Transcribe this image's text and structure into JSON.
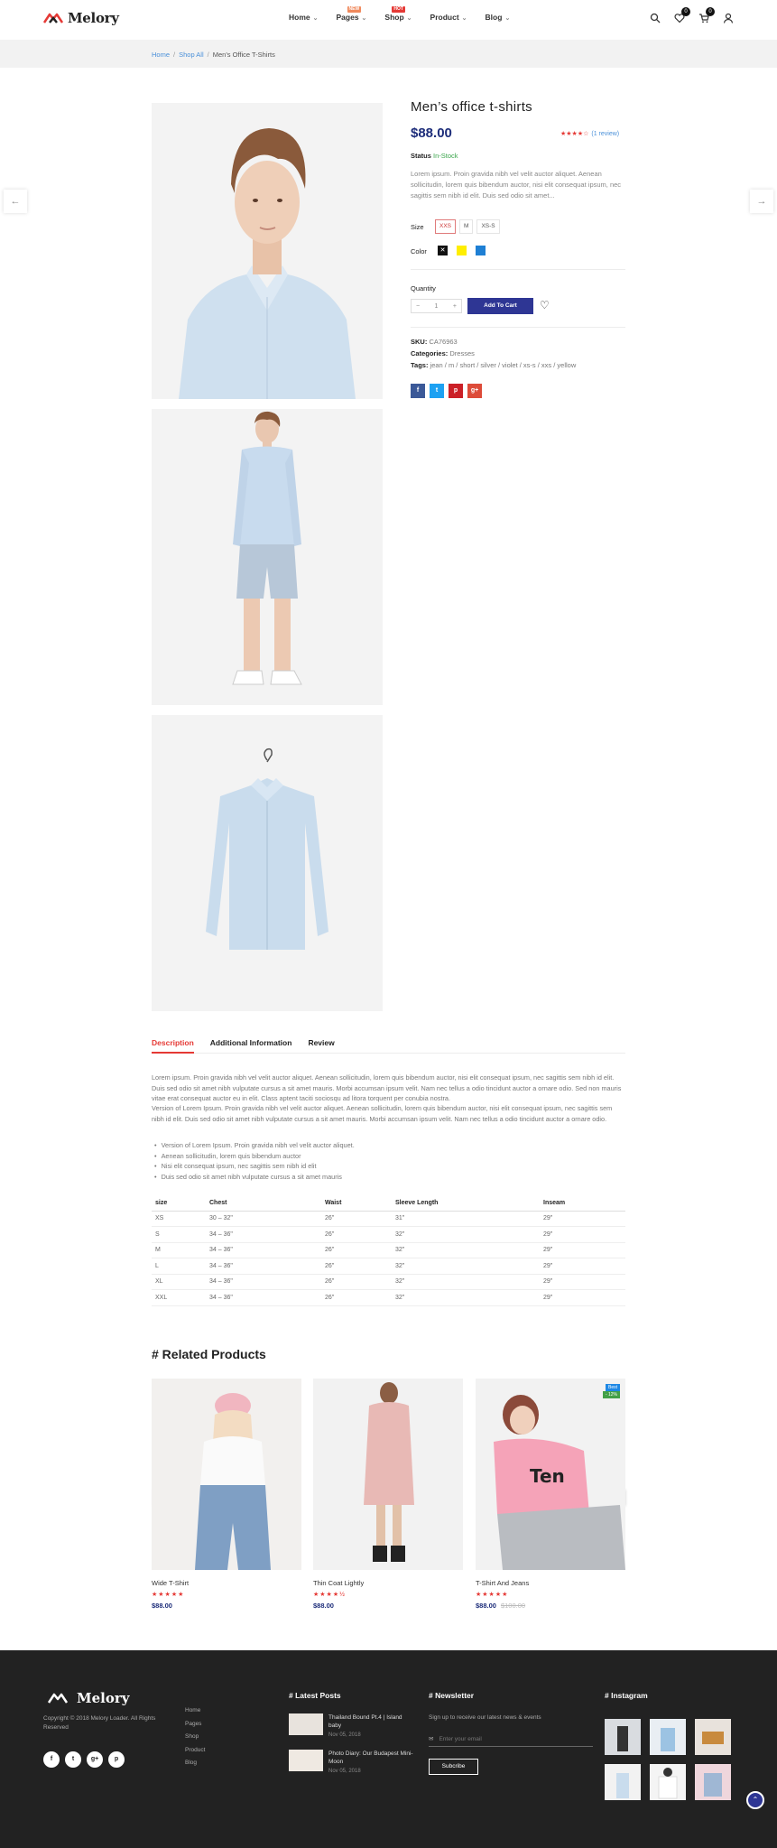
{
  "header": {
    "logo_text": "Melory",
    "nav": [
      {
        "label": "Home",
        "badge": ""
      },
      {
        "label": "Pages",
        "badge": "NEW"
      },
      {
        "label": "Shop",
        "badge": "HOT"
      },
      {
        "label": "Product",
        "badge": ""
      },
      {
        "label": "Blog",
        "badge": ""
      }
    ],
    "wishlist_count": "0",
    "cart_count": "0",
    "badge_colors": {
      "new": "#f08a5d",
      "hot": "#e53935"
    }
  },
  "breadcrumb": {
    "items": [
      "Home",
      "Shop All",
      "Men's Office T-Shirts"
    ],
    "separator": "/"
  },
  "product": {
    "title": "Men’s office t-shirts",
    "price": "$88.00",
    "rating": 4,
    "rating_max": 5,
    "review_text": "(1 review)",
    "status_label": "Status",
    "status_value": "In-Stock",
    "short_description": "Lorem ipsum. Proin gravida nibh vel velit auctor aliquet. Aenean sollicitudin, lorem quis bibendum auctor, nisi elit consequat ipsum, nec sagittis sem nibh id elit. Duis sed odio sit amet...",
    "size_label": "Size",
    "sizes": [
      "XXS",
      "M",
      "XS-S"
    ],
    "selected_size": "XXS",
    "color_label": "Color",
    "colors": [
      "#111111",
      "#ffee00",
      "#1e7fd4"
    ],
    "quantity_label": "Quantity",
    "quantity": "1",
    "add_to_cart": "Add To Cart",
    "sku_label": "SKU:",
    "sku": "CA76963",
    "categories_label": "Categories:",
    "categories": "Dresses",
    "tags_label": "Tags:",
    "tags": "jean  /  m  /  short  /  silver  /  violet  /  xs-s  /  xxs  /  yellow",
    "share_icons": [
      "f",
      "t",
      "p",
      "g+"
    ],
    "share_colors": [
      "#3b5998",
      "#1da1f2",
      "#cb2027",
      "#dd4b39"
    ]
  },
  "tabs": {
    "items": [
      "Description",
      "Additional Information",
      "Review"
    ],
    "active": 0
  },
  "description": {
    "paragraph1": "Lorem ipsum. Proin gravida nibh vel velit auctor aliquet. Aenean sollicitudin, lorem quis bibendum auctor, nisi elit consequat ipsum, nec sagittis sem nibh id elit. Duis sed odio sit amet nibh vulputate cursus a sit amet mauris. Morbi accumsan ipsum velit. Nam nec tellus a odio tincidunt auctor a ornare odio. Sed non mauris vitae erat consequat auctor eu in elit. Class aptent taciti sociosqu ad litora torquent per conubia nostra.",
    "paragraph2": "Version of Lorem Ipsum. Proin gravida nibh vel velit auctor aliquet. Aenean sollicitudin, lorem quis bibendum auctor, nisi elit consequat ipsum, nec sagittis sem nibh id elit. Duis sed odio sit amet nibh vulputate cursus a sit amet mauris. Morbi accumsan ipsum velit. Nam nec tellus a odio tincidunt auctor a ornare odio.",
    "bullets": [
      "Version of Lorem Ipsum. Proin gravida nibh vel velit auctor aliquet.",
      "Aenean sollicitudin, lorem quis bibendum auctor",
      "Nisi elit consequat ipsum, nec sagittis sem nibh id elit",
      "Duis sed odio sit amet nibh vulputate cursus a sit amet mauris"
    ]
  },
  "size_table": {
    "headers": [
      "size",
      "Chest",
      "Waist",
      "Sleeve Length",
      "Inseam"
    ],
    "rows": [
      [
        "XS",
        "30 – 32\"",
        "26\"",
        "31\"",
        "29\""
      ],
      [
        "S",
        "34 – 36\"",
        "26\"",
        "32\"",
        "29\""
      ],
      [
        "M",
        "34 – 36\"",
        "26\"",
        "32\"",
        "29\""
      ],
      [
        "L",
        "34 – 36\"",
        "26\"",
        "32\"",
        "29\""
      ],
      [
        "XL",
        "34 – 36\"",
        "26\"",
        "32\"",
        "29\""
      ],
      [
        "XXL",
        "34 – 36\"",
        "26\"",
        "32\"",
        "29\""
      ]
    ]
  },
  "related": {
    "title": "# Related Products",
    "items": [
      {
        "name": "Wide T-Shirt",
        "price": "$88.00",
        "old_price": "",
        "rating": 5,
        "tag1": "",
        "tag2": ""
      },
      {
        "name": "Thin Coat Lightly",
        "price": "$88.00",
        "old_price": "",
        "rating": 4.5,
        "tag1": "",
        "tag2": ""
      },
      {
        "name": "T-Shirt And Jeans",
        "price": "$88.00",
        "old_price": "$100.00",
        "rating": 5,
        "tag1": "Best",
        "tag2": "- 12%"
      }
    ]
  },
  "footer": {
    "logo_text": "Melory",
    "copyright": "Copyright © 2018 Melory Loader. All Rights Reserved",
    "social": [
      "f",
      "t",
      "g+",
      "p"
    ],
    "links": [
      "Home",
      "Pages",
      "Shop",
      "Product",
      "Blog"
    ],
    "latest_title": "# Latest Posts",
    "posts": [
      {
        "title": "Thailand Bound Pt.4 | Island baby",
        "date": "Nov 05, 2018"
      },
      {
        "title": "Photo Diary: Our Budapest Mini-Moon",
        "date": "Nov 05, 2018"
      }
    ],
    "newsletter_title": "# Newsletter",
    "newsletter_text": "Sign up to receive our latest news & events",
    "email_placeholder": "Enter your email",
    "subscribe": "Subcribe",
    "instagram_title": "# Instagram"
  }
}
